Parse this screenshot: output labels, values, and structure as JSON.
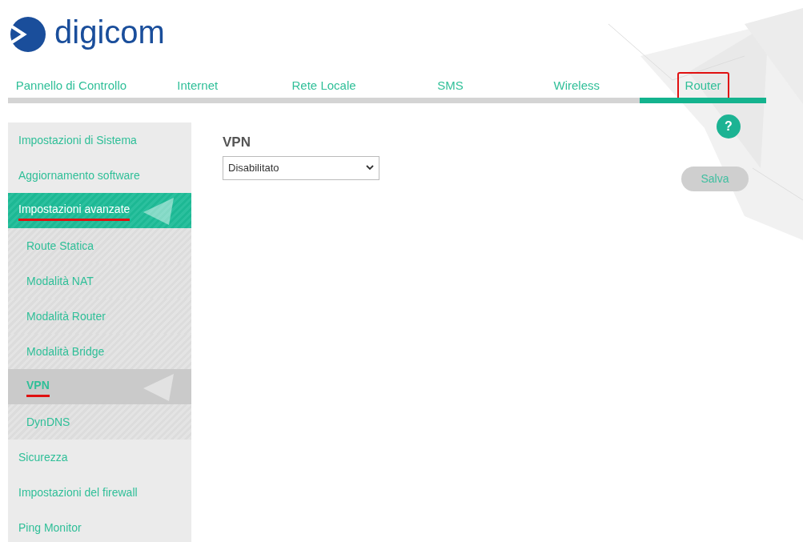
{
  "logo": {
    "text": "digicom"
  },
  "tabs": [
    {
      "label": "Pannello di Controllo",
      "selected": false,
      "marked": false
    },
    {
      "label": "Internet",
      "selected": false,
      "marked": false
    },
    {
      "label": "Rete Locale",
      "selected": false,
      "marked": false
    },
    {
      "label": "SMS",
      "selected": false,
      "marked": false
    },
    {
      "label": "Wireless",
      "selected": false,
      "marked": false
    },
    {
      "label": "Router",
      "selected": true,
      "marked": true
    }
  ],
  "sidebar": {
    "items": [
      {
        "label": "Impostazioni di Sistema",
        "selected": false,
        "marked": false
      },
      {
        "label": "Aggiornamento software",
        "selected": false,
        "marked": false
      },
      {
        "label": "Impostazioni avanzate",
        "selected": true,
        "marked": true,
        "children": [
          {
            "label": "Route Statica",
            "selected": false,
            "marked": false
          },
          {
            "label": "Modalità NAT",
            "selected": false,
            "marked": false
          },
          {
            "label": "Modalità Router",
            "selected": false,
            "marked": false
          },
          {
            "label": "Modalità Bridge",
            "selected": false,
            "marked": false
          },
          {
            "label": "VPN",
            "selected": true,
            "marked": true
          },
          {
            "label": "DynDNS",
            "selected": false,
            "marked": false
          }
        ]
      },
      {
        "label": "Sicurezza",
        "selected": false,
        "marked": false
      },
      {
        "label": "Impostazioni del firewall",
        "selected": false,
        "marked": false
      },
      {
        "label": "Ping Monitor",
        "selected": false,
        "marked": false
      }
    ]
  },
  "content": {
    "title": "VPN",
    "select": {
      "value": "Disabilitato"
    },
    "help": "?",
    "save_button": "Salva"
  }
}
